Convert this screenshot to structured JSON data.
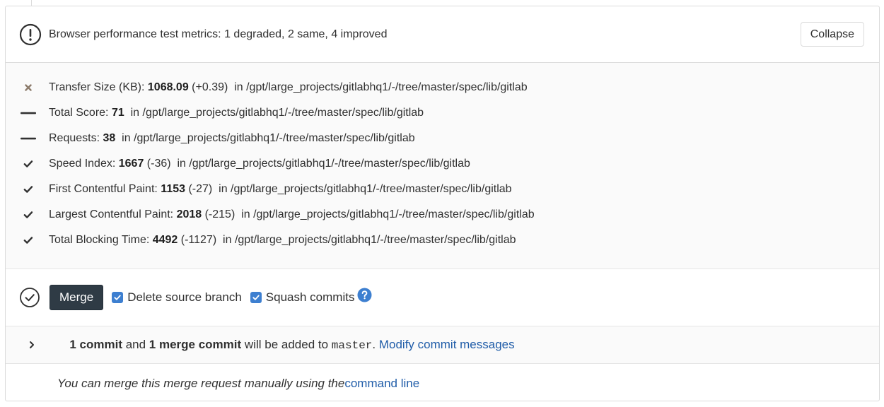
{
  "header": {
    "prefix": "Browser performance test metrics: ",
    "degraded_count": "1",
    "degraded_label": " degraded, ",
    "same_count": "2",
    "same_label": " same, ",
    "improved_count": "4",
    "improved_label": " improved",
    "collapse_label": "Collapse",
    "icon": "warning-icon"
  },
  "metrics": [
    {
      "status": "degraded",
      "icon": "close-icon",
      "label": "Transfer Size (KB): ",
      "value": "1068.09",
      "delta": " (+0.39) ",
      "path_prefix": " in ",
      "path": "/gpt/large_projects/gitlabhq1/-/tree/master/spec/lib/gitlab"
    },
    {
      "status": "same",
      "icon": "minus-icon",
      "label": "Total Score: ",
      "value": "71",
      "delta": "",
      "path_prefix": "  in ",
      "path": "/gpt/large_projects/gitlabhq1/-/tree/master/spec/lib/gitlab"
    },
    {
      "status": "same",
      "icon": "minus-icon",
      "label": "Requests: ",
      "value": "38",
      "delta": "",
      "path_prefix": "  in ",
      "path": "/gpt/large_projects/gitlabhq1/-/tree/master/spec/lib/gitlab"
    },
    {
      "status": "improved",
      "icon": "check-icon",
      "label": "Speed Index: ",
      "value": "1667",
      "delta": " (-36) ",
      "path_prefix": " in ",
      "path": "/gpt/large_projects/gitlabhq1/-/tree/master/spec/lib/gitlab"
    },
    {
      "status": "improved",
      "icon": "check-icon",
      "label": "First Contentful Paint: ",
      "value": "1153",
      "delta": " (-27) ",
      "path_prefix": " in ",
      "path": "/gpt/large_projects/gitlabhq1/-/tree/master/spec/lib/gitlab"
    },
    {
      "status": "improved",
      "icon": "check-icon",
      "label": "Largest Contentful Paint: ",
      "value": "2018",
      "delta": " (-215) ",
      "path_prefix": " in ",
      "path": "/gpt/large_projects/gitlabhq1/-/tree/master/spec/lib/gitlab"
    },
    {
      "status": "improved",
      "icon": "check-icon",
      "label": "Total Blocking Time: ",
      "value": "4492",
      "delta": " (-1127) ",
      "path_prefix": " in ",
      "path": "/gpt/large_projects/gitlabhq1/-/tree/master/spec/lib/gitlab"
    }
  ],
  "merge": {
    "button_label": "Merge",
    "delete_branch_label": "Delete source branch",
    "delete_branch_checked": true,
    "squash_label": "Squash commits",
    "squash_checked": true,
    "status_icon": "check-circle-icon",
    "help_icon": "question-icon"
  },
  "commit_info": {
    "commit_count": "1 commit",
    "and": " and ",
    "merge_commit": "1 merge commit",
    "middle": " will be added to ",
    "branch": "master",
    "period": ". ",
    "modify_link": "Modify commit messages"
  },
  "footer": {
    "text": "You can merge this merge request manually using the ",
    "link": "command line"
  },
  "colors": {
    "link": "#1f5ca8",
    "merge_button": "#2f3b45",
    "checkbox": "#3d7fd0",
    "degraded_icon": "#8c7b6b"
  }
}
